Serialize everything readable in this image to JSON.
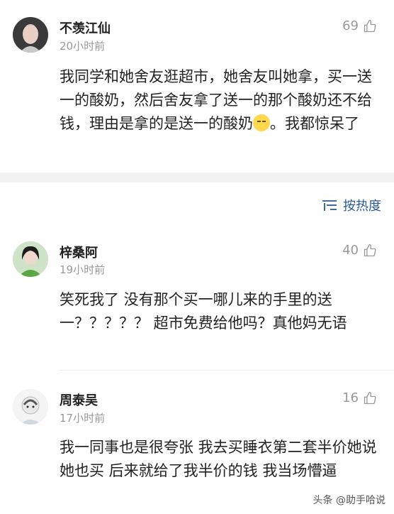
{
  "comments": [
    {
      "name": "不羡江仙",
      "time": "20小时前",
      "likes": "69",
      "text": "我同学和她舍友逛超市，她舍友叫她拿，买一送一的酸奶，然后舍友拿了送一的那个酸奶还不给钱，理由是拿的是送一的酸奶",
      "text_tail": "。我都惊呆了"
    },
    {
      "name": "梓桑阿",
      "time": "19小时前",
      "likes": "40",
      "text": "笑死我了 没有那个买一哪儿来的手里的送一？？？？？ 超市免费给他吗？真他妈无语"
    },
    {
      "name": "周泰吴",
      "time": "17小时前",
      "likes": "16",
      "text": "我一同事也是很夸张 我去买睡衣第二套半价她说她也买 后来就给了我半价的钱 我当场懵逼"
    }
  ],
  "sort": {
    "label": "按热度"
  },
  "watermark": {
    "text": "头条 @助手哈说"
  },
  "colors": {
    "sort_blue": "#2a5a9b",
    "meta_gray": "#999999"
  }
}
